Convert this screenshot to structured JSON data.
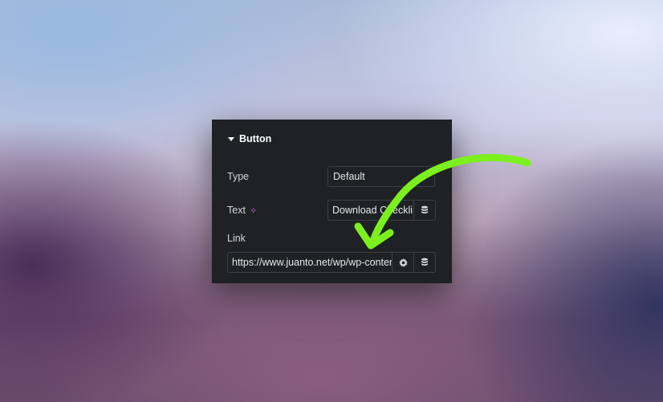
{
  "section": {
    "title": "Button"
  },
  "type_field": {
    "label": "Type",
    "value": "Default"
  },
  "text_field": {
    "label": "Text",
    "value": "Download Checkli"
  },
  "link_field": {
    "label": "Link",
    "value": "https://www.juanto.net/wp/wp-conten"
  },
  "icons": {
    "caret": "caret-down-icon",
    "ai": "sparkle-icon",
    "dynamic": "database-icon",
    "settings": "gear-icon"
  },
  "colors": {
    "panel_bg": "#1f2124",
    "accent_arrow": "#7cf01f",
    "sparkle": "#c86fe6"
  }
}
